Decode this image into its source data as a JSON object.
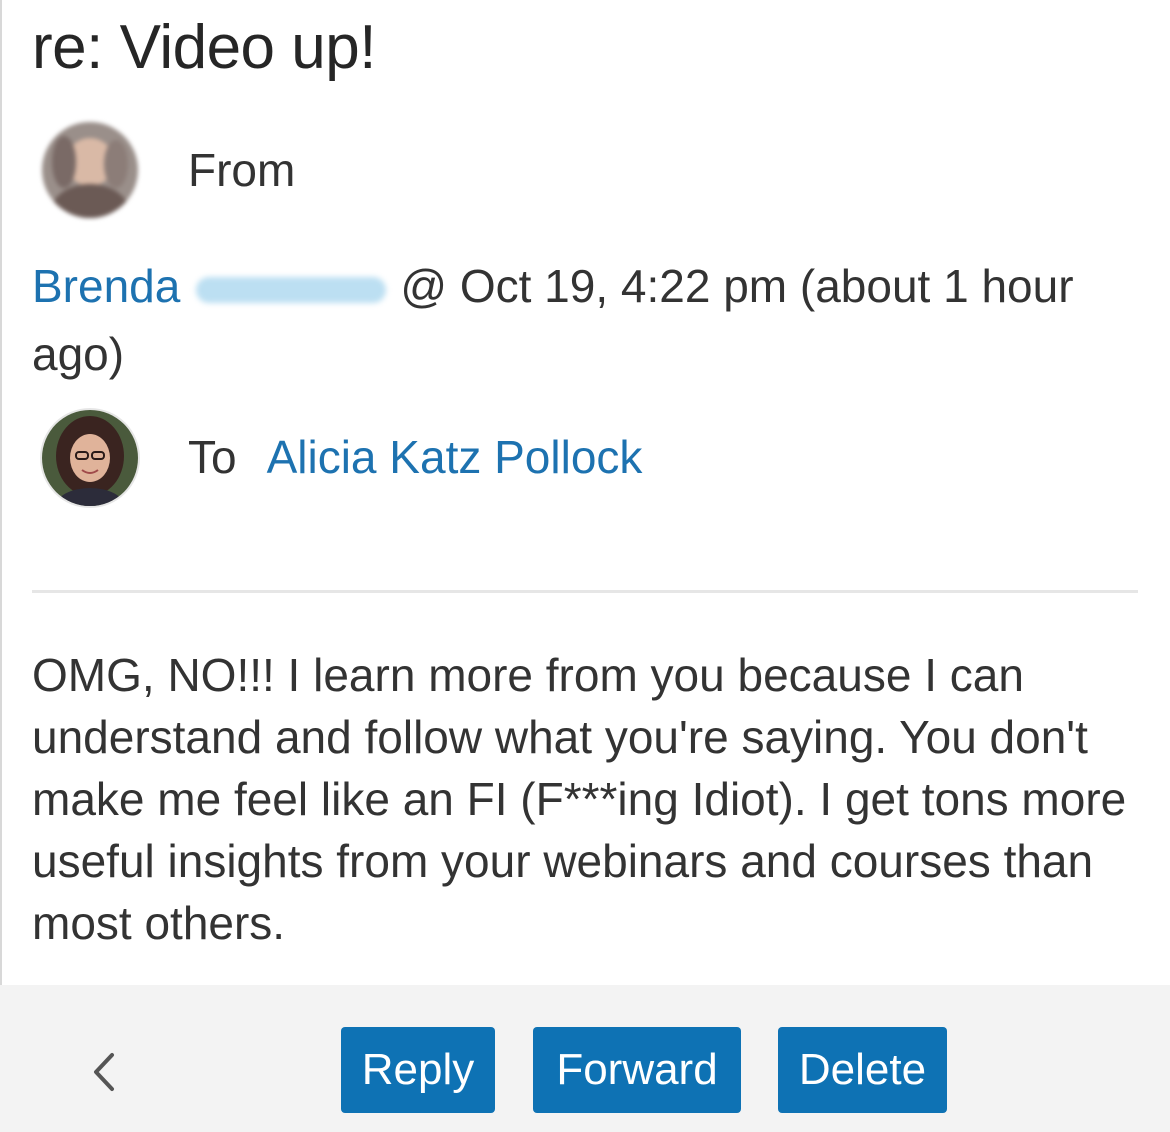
{
  "message": {
    "subject": "re: Video up!",
    "from_label": "From",
    "sender_name": "Brenda",
    "sent_info": "@ Oct 19, 4:22 pm (about 1 hour ago)",
    "to_label": "To",
    "recipient_name": "Alicia Katz Pollock",
    "body": "OMG, NO!!! I learn more from you because I can understand and follow what you're saying. You don't make me feel like an FI (F***ing Idiot). I get tons more useful insights from your webinars and courses than most others."
  },
  "footer": {
    "back_glyph": "‹",
    "reply_label": "Reply",
    "forward_label": "Forward",
    "delete_label": "Delete"
  },
  "colors": {
    "accent": "#0e72b4",
    "link": "#1d72b0",
    "footer_bg": "#f3f3f3"
  },
  "icons": {
    "back": "chevron-left-icon"
  }
}
